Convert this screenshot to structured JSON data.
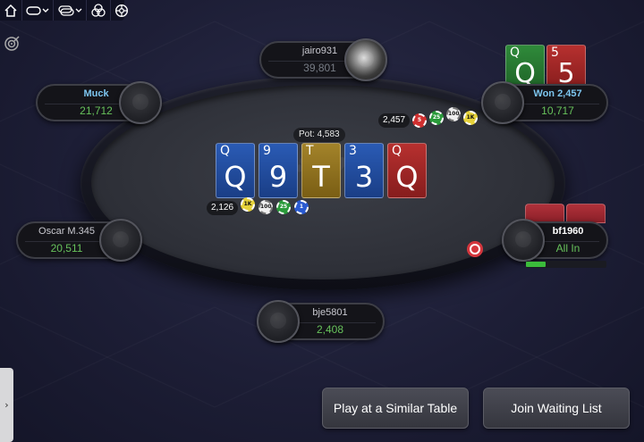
{
  "toolbar": {
    "icons": [
      "home-icon",
      "chat-menu-icon",
      "table-menu-icon",
      "rebuy-icon",
      "settings-icon"
    ]
  },
  "pot": {
    "label": "Pot: 4,583"
  },
  "board": [
    {
      "rank": "Q",
      "suit_color": "blue"
    },
    {
      "rank": "9",
      "suit_color": "blue"
    },
    {
      "rank": "T",
      "suit_color": "gold"
    },
    {
      "rank": "3",
      "suit_color": "blue"
    },
    {
      "rank": "Q",
      "suit_color": "red"
    }
  ],
  "players": {
    "top": {
      "name": "jairo931",
      "stack": "39,801"
    },
    "top_left": {
      "name": "Muck",
      "stack": "21,712"
    },
    "top_right": {
      "name": "Won 2,457",
      "stack": "10,717",
      "hole_cards": [
        "Q",
        "5"
      ]
    },
    "left": {
      "name": "Oscar M.345",
      "stack": "20,511"
    },
    "right": {
      "name": "bf1960",
      "stack": "All In"
    },
    "bottom": {
      "name": "bje5801",
      "stack": "2,408"
    }
  },
  "bets": {
    "top_right": {
      "amount": "2,457",
      "chips": [
        "5",
        "25",
        "100",
        "1K"
      ]
    },
    "left_center": {
      "amount": "2,126",
      "chips": [
        "1K",
        "100",
        "25",
        "1"
      ]
    }
  },
  "buttons": {
    "similar_table": "Play at a Similar Table",
    "waiting_list": "Join Waiting List"
  },
  "side_tab": {
    "glyph": "›"
  },
  "colors": {
    "stack_green": "#67c25b",
    "name_blue": "#7dc6f0",
    "card_blue": "#2a5bb5",
    "card_gold": "#a3832a",
    "card_red": "#b7302f"
  }
}
